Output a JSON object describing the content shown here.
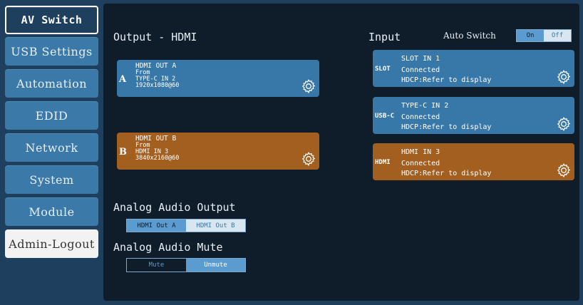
{
  "sidebar": {
    "items": [
      {
        "label": "AV Switch",
        "active": true
      },
      {
        "label": "USB Settings"
      },
      {
        "label": "Automation"
      },
      {
        "label": "EDID"
      },
      {
        "label": "Network"
      },
      {
        "label": "System"
      },
      {
        "label": "Module"
      },
      {
        "label": "Admin-Logout"
      }
    ]
  },
  "output": {
    "title": "Output - HDMI",
    "cards": [
      {
        "letter": "A",
        "name": "HDMI OUT A",
        "from_label": "From",
        "source": "TYPE-C IN 2",
        "resolution": "1920x1080@60",
        "color": "#3878a8"
      },
      {
        "letter": "B",
        "name": "HDMI OUT B",
        "from_label": "From",
        "source": "HDMI IN 3",
        "resolution": "3840x2160@60",
        "color": "#a35f20"
      }
    ]
  },
  "input": {
    "title": "Input",
    "auto_switch_label": "Auto Switch",
    "auto_switch_on": "On",
    "auto_switch_off": "Off",
    "auto_switch_selected": "On",
    "cards": [
      {
        "tag": "SLOT",
        "name": "SLOT IN 1",
        "status": "Connected",
        "hdcp": "HDCP:Refer to display",
        "color": "#3878a8"
      },
      {
        "tag": "USB-C",
        "name": "TYPE-C IN 2",
        "status": "Connected",
        "hdcp": "HDCP:Refer to display",
        "color": "#3878a8"
      },
      {
        "tag": "HDMI",
        "name": "HDMI IN 3",
        "status": "Connected",
        "hdcp": "HDCP:Refer to display",
        "color": "#a35f20"
      }
    ]
  },
  "analog_output": {
    "title": "Analog Audio Output",
    "option_a": "HDMI Out A",
    "option_b": "HDMI Out B",
    "selected": "HDMI Out A"
  },
  "analog_mute": {
    "title": "Analog Audio Mute",
    "option_mute": "Mute",
    "option_unmute": "Unmute",
    "selected": "Unmute"
  },
  "icons": {
    "gear": "gear-icon"
  }
}
